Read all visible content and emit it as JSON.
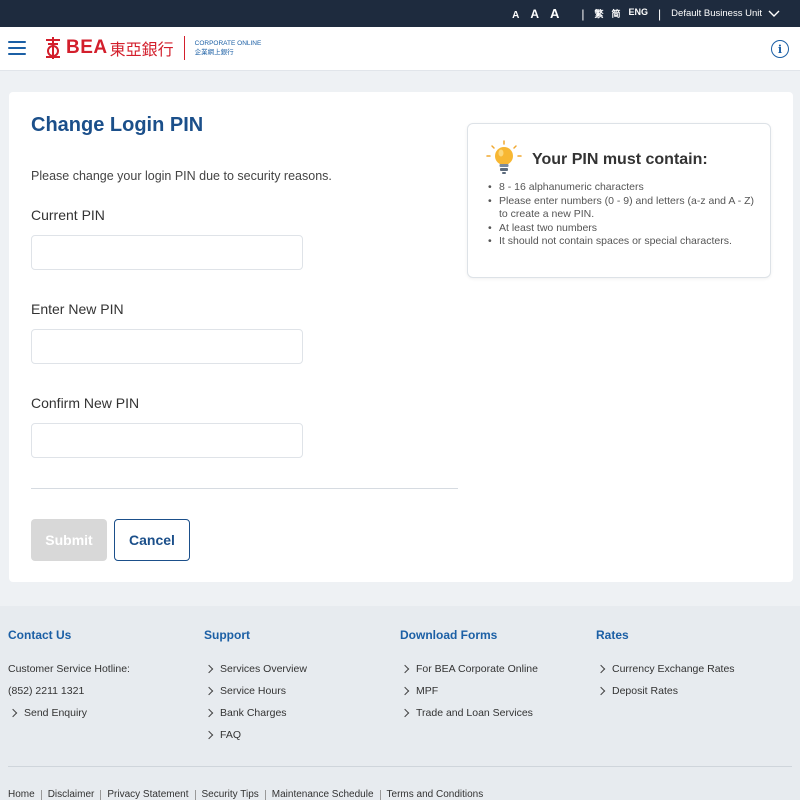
{
  "topbar": {
    "font_sizes": [
      "A",
      "A",
      "A"
    ],
    "lang_tc": "繁",
    "lang_sc": "简",
    "lang_en": "ENG",
    "business_unit": "Default Business Unit"
  },
  "header": {
    "logo_text": "BEA",
    "logo_cn": "東亞銀行",
    "sub_en": "CORPORATE ONLINE",
    "sub_cn": "企業網上銀行",
    "info": "i"
  },
  "form": {
    "title": "Change Login PIN",
    "intro": "Please change your login PIN due to security reasons.",
    "current_label": "Current PIN",
    "current_value": "",
    "new_label": "Enter New PIN",
    "new_value": "",
    "confirm_label": "Confirm New PIN",
    "confirm_value": "",
    "submit": "Submit",
    "cancel": "Cancel"
  },
  "rules": {
    "title": "Your PIN must contain:",
    "items": [
      "8 - 16 alphanumeric characters",
      "Please enter numbers (0 - 9) and letters (a-z and A - Z) to create a new PIN.",
      "At least two numbers",
      "It should not contain spaces or special characters."
    ]
  },
  "footer": {
    "contact": {
      "title": "Contact Us",
      "hotline_label": "Customer Service Hotline:",
      "hotline": "(852) 2211 1321",
      "enquiry": "Send Enquiry"
    },
    "support": {
      "title": "Support",
      "items": [
        "Services Overview",
        "Service Hours",
        "Bank Charges",
        "FAQ"
      ]
    },
    "forms": {
      "title": "Download Forms",
      "items": [
        "For BEA Corporate Online",
        "MPF",
        "Trade and Loan Services"
      ]
    },
    "rates": {
      "title": "Rates",
      "items": [
        "Currency Exchange Rates",
        "Deposit Rates"
      ]
    },
    "links": [
      "Home",
      "Disclaimer",
      "Privacy Statement",
      "Security Tips",
      "Maintenance Schedule",
      "Terms and Conditions"
    ]
  },
  "colors": {
    "brand_blue": "#1b4f8a",
    "brand_red": "#d31f2c",
    "topbar": "#1e2b3e"
  }
}
